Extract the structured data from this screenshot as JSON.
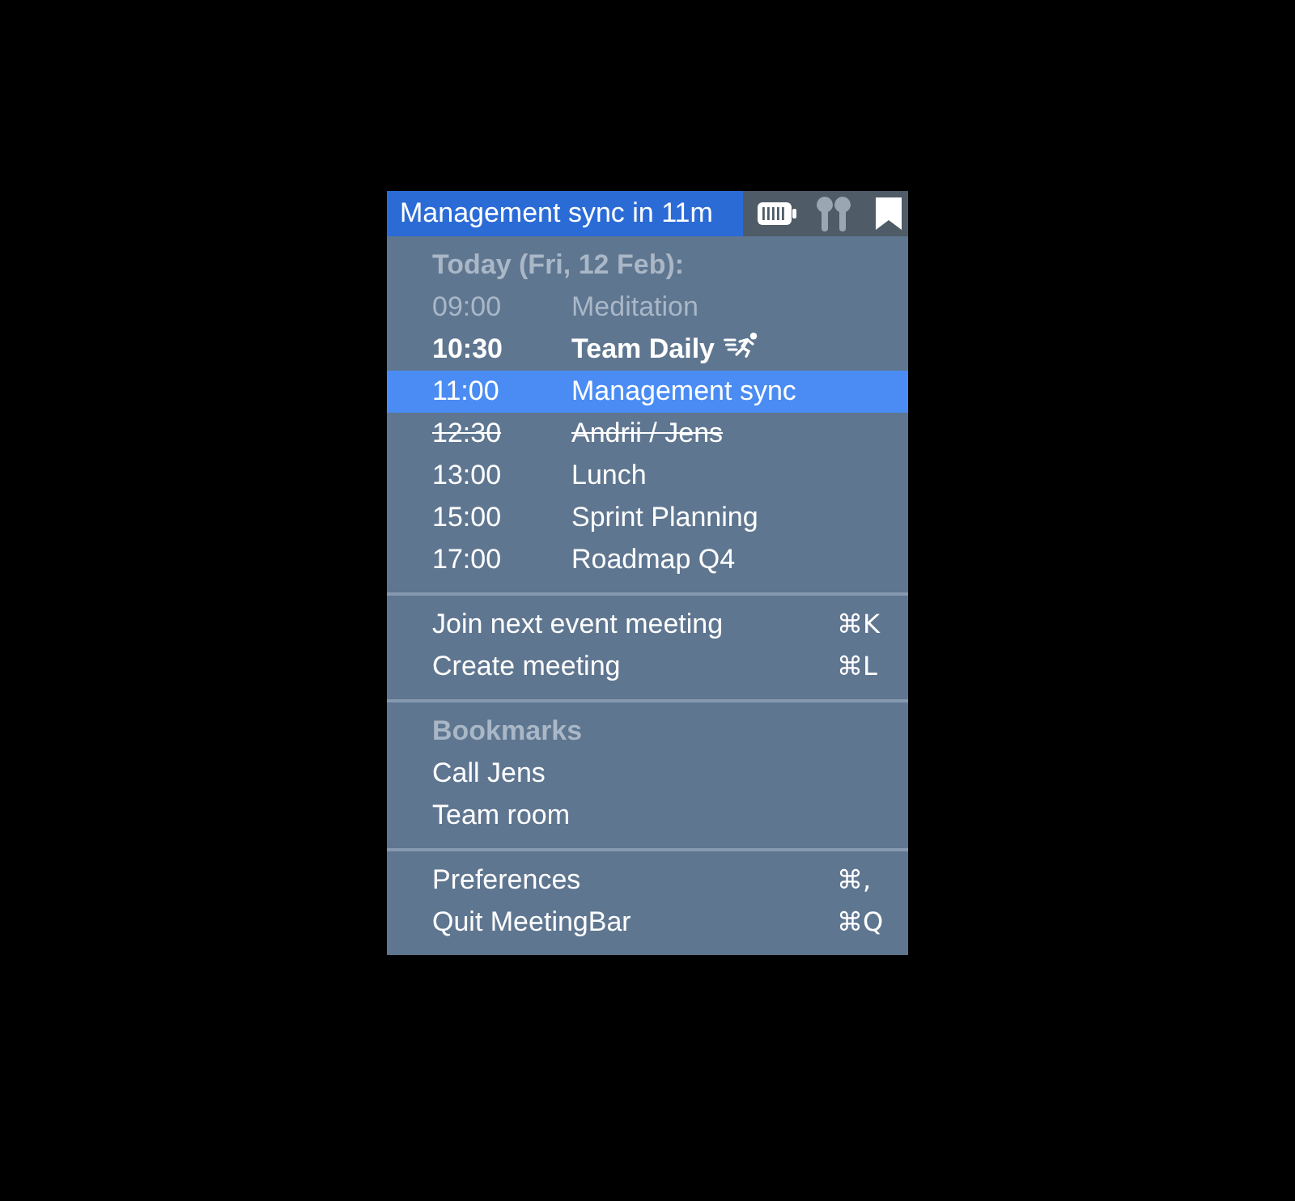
{
  "menu_bar": {
    "title": "Management sync in 11m"
  },
  "sections": [
    {
      "kind": "events",
      "header": "Today (Fri, 12 Feb):",
      "events": [
        {
          "time": "09:00",
          "title": "Meditation",
          "past": true,
          "in_progress": false,
          "declined": false,
          "selected": false
        },
        {
          "time": "10:30",
          "title": "Team Daily",
          "past": false,
          "in_progress": true,
          "declined": false,
          "selected": false
        },
        {
          "time": "11:00",
          "title": "Management sync",
          "past": false,
          "in_progress": false,
          "declined": false,
          "selected": true
        },
        {
          "time": "12:30",
          "title": "Andrii / Jens",
          "past": false,
          "in_progress": false,
          "declined": true,
          "selected": false
        },
        {
          "time": "13:00",
          "title": "Lunch",
          "past": false,
          "in_progress": false,
          "declined": false,
          "selected": false
        },
        {
          "time": "15:00",
          "title": "Sprint Planning",
          "past": false,
          "in_progress": false,
          "declined": false,
          "selected": false
        },
        {
          "time": "17:00",
          "title": "Roadmap Q4",
          "past": false,
          "in_progress": false,
          "declined": false,
          "selected": false
        }
      ]
    },
    {
      "kind": "actions",
      "items": [
        {
          "label": "Join next event meeting",
          "shortcut": "⌘K"
        },
        {
          "label": "Create meeting",
          "shortcut": "⌘L"
        }
      ]
    },
    {
      "kind": "bookmarks",
      "header": "Bookmarks",
      "items": [
        {
          "label": "Call Jens"
        },
        {
          "label": "Team room"
        }
      ]
    },
    {
      "kind": "actions",
      "items": [
        {
          "label": "Preferences",
          "shortcut": "⌘,"
        },
        {
          "label": "Quit MeetingBar",
          "shortcut": "⌘Q"
        }
      ]
    }
  ]
}
